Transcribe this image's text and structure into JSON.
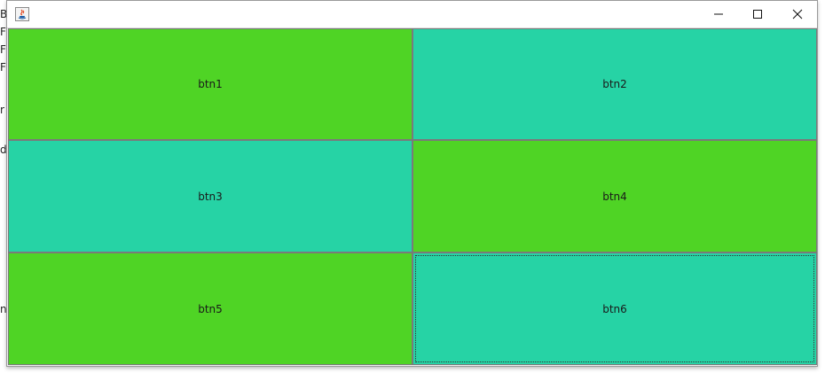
{
  "background_window": {
    "fragments": [
      "Bo",
      "Fl",
      "Fr",
      "Fr",
      "r",
      "d",
      "n"
    ]
  },
  "window": {
    "title": "",
    "controls": {
      "minimize_icon": "minimize-icon",
      "maximize_icon": "maximize-icon",
      "close_icon": "close-icon"
    }
  },
  "buttons": [
    {
      "label": "btn1",
      "color": "#4fd425"
    },
    {
      "label": "btn2",
      "color": "#26d3a5"
    },
    {
      "label": "btn3",
      "color": "#26d3a5"
    },
    {
      "label": "btn4",
      "color": "#4fd425"
    },
    {
      "label": "btn5",
      "color": "#4fd425"
    },
    {
      "label": "btn6",
      "color": "#26d3a5",
      "focused": true
    }
  ]
}
